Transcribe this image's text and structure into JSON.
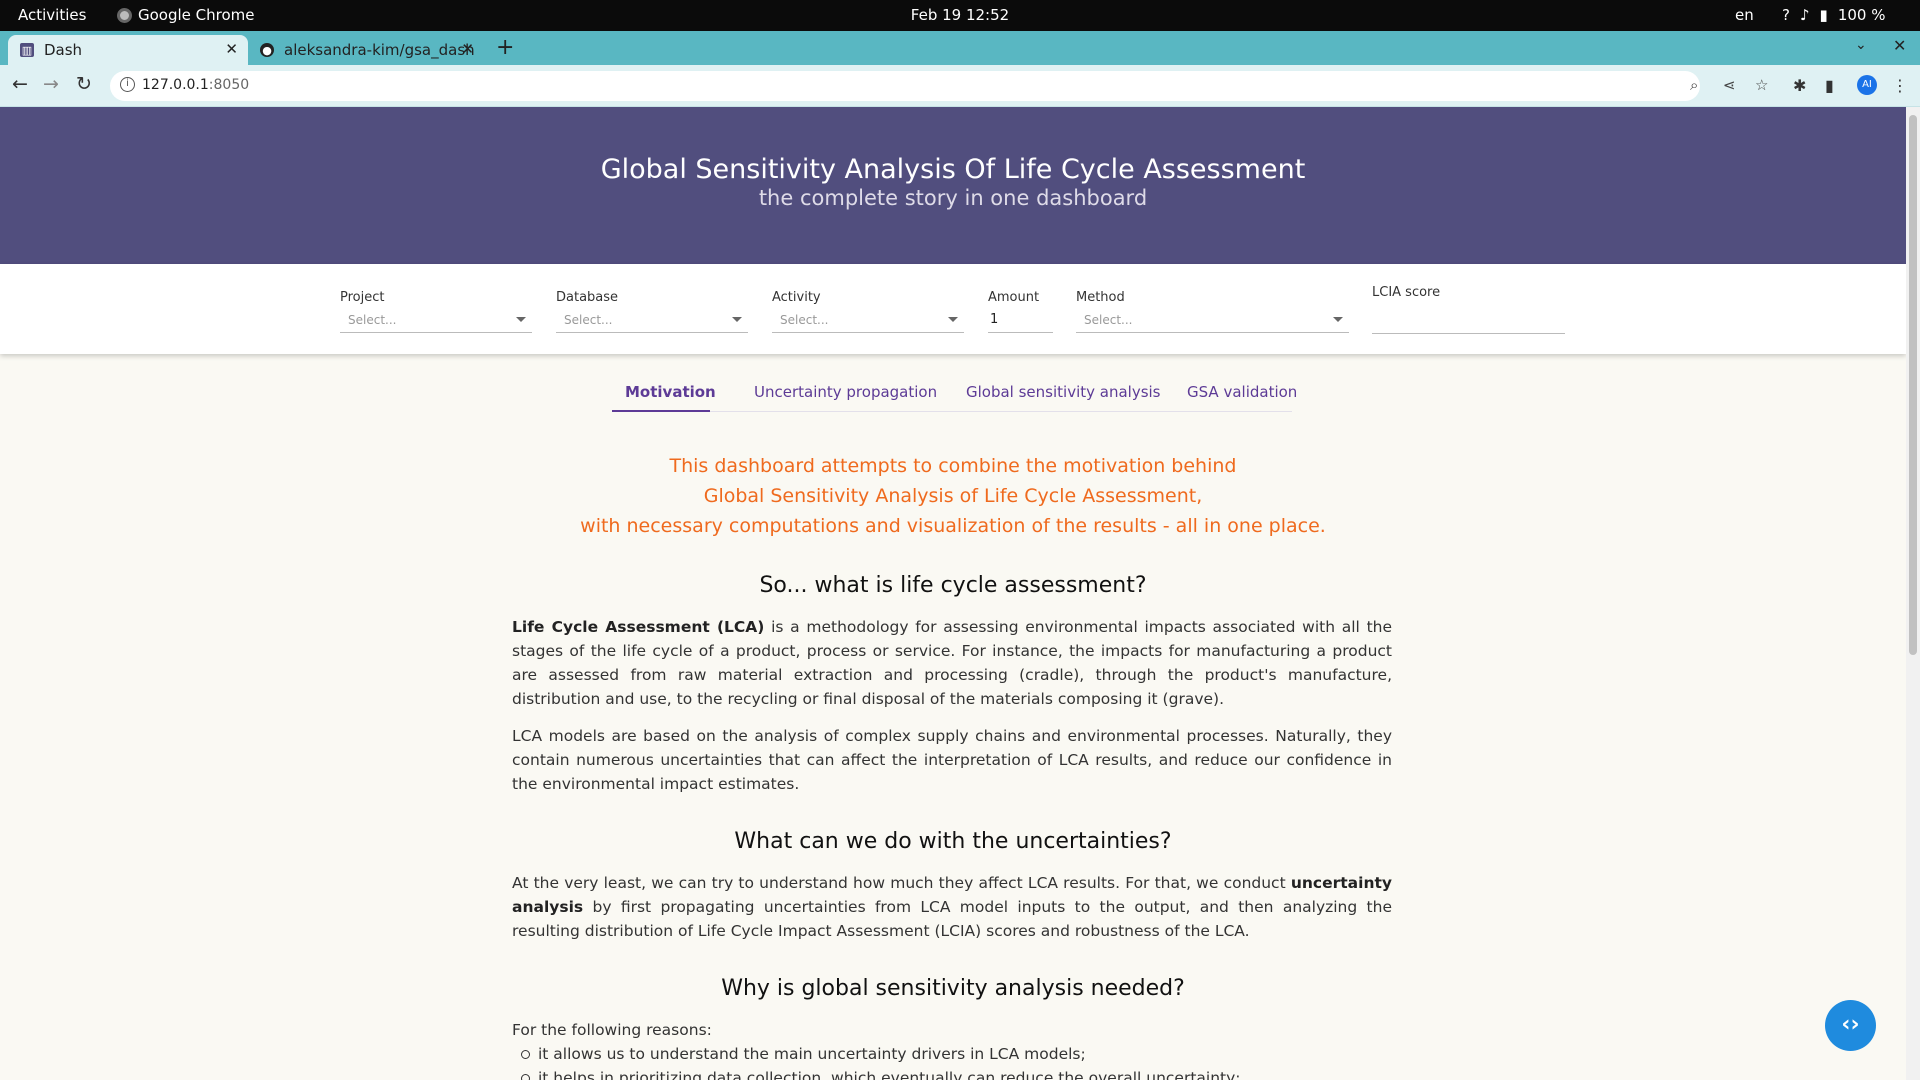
{
  "system_bar": {
    "activities": "Activities",
    "app_name": "Google Chrome",
    "clock": "Feb 19  12:52",
    "language": "en",
    "battery": "100 %"
  },
  "browser": {
    "tabs": [
      {
        "title": "Dash"
      },
      {
        "title": "aleksandra-kim/gsa_dash"
      }
    ],
    "url_host": "127.0.0.1",
    "url_port": ":8050",
    "profile_initials": "AI"
  },
  "header": {
    "title": "Global Sensitivity Analysis Of Life Cycle Assessment",
    "subtitle": "the complete story in one dashboard"
  },
  "controls": {
    "project": {
      "label": "Project",
      "placeholder": "Select..."
    },
    "database": {
      "label": "Database",
      "placeholder": "Select..."
    },
    "activity": {
      "label": "Activity",
      "placeholder": "Select..."
    },
    "amount": {
      "label": "Amount",
      "value": "1"
    },
    "method": {
      "label": "Method",
      "placeholder": "Select..."
    },
    "lcia_score": {
      "label": "LCIA score",
      "value": ""
    }
  },
  "page_tabs": [
    {
      "label": "Motivation",
      "active": true
    },
    {
      "label": "Uncertainty propagation",
      "active": false
    },
    {
      "label": "Global sensitivity analysis",
      "active": false
    },
    {
      "label": "GSA validation",
      "active": false
    }
  ],
  "intro": {
    "line1": "This dashboard attempts to combine the motivation behind",
    "line2": "Global Sensitivity Analysis of Life Cycle Assessment,",
    "line3": "with necessary computations and visualization of the results - all in one place."
  },
  "sections": {
    "lca_heading": "So... what is life cycle assessment?",
    "lca_p1_bold": "Life Cycle Assessment (LCA)",
    "lca_p1_rest": " is a methodology for assessing environmental impacts associated with all the stages of the life cycle of a product, process or service. For instance, the impacts for manufacturing a product are assessed from raw material extraction and processing (cradle), through the product's manufacture, distribution and use, to the recycling or final disposal of the materials composing it (grave).",
    "lca_p2": "LCA models are based on the analysis of complex supply chains and environmental processes. Naturally, they contain numerous uncertainties that can affect the interpretation of LCA results, and reduce our confidence in the environmental impact estimates.",
    "unc_heading": "What can we do with the uncertainties?",
    "unc_p1_a": "At the very least, we can try to understand how much they affect LCA results. For that, we conduct ",
    "unc_p1_bold": "uncertainty analysis",
    "unc_p1_b": " by first propagating uncertainties from LCA model inputs to the output, and then analyzing the resulting distribution of Life Cycle Impact Assessment (LCIA) scores and robustness of the LCA.",
    "gsa_heading": "Why is global sensitivity analysis needed?",
    "reasons_intro": "For the following reasons:",
    "reasons": [
      "it allows us to understand the main uncertainty drivers in LCA models;",
      "it helps in prioritizing data collection, which eventually can reduce the overall uncertainty;"
    ]
  },
  "colors": {
    "banner": "#514e7e",
    "accent_tab": "#5d3b96",
    "intro_text": "#ef6a1e",
    "fab": "#1f8bde"
  }
}
